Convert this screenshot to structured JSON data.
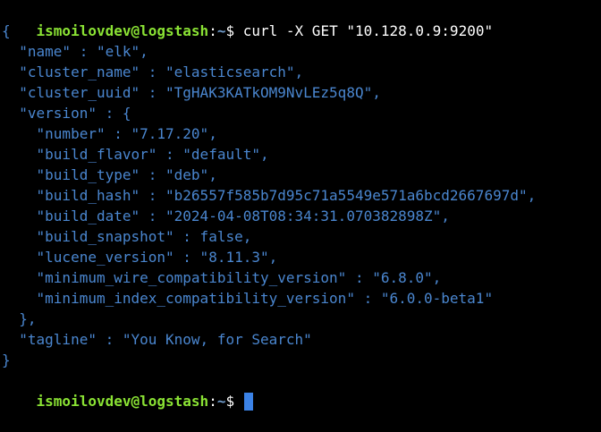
{
  "prompt": {
    "user_host": "ismoilovdev@logstash",
    "separator": ":",
    "path": "~",
    "symbol": "$"
  },
  "command": " curl -X GET \"10.128.0.9:9200\"",
  "output": [
    "{",
    "  \"name\" : \"elk\",",
    "  \"cluster_name\" : \"elasticsearch\",",
    "  \"cluster_uuid\" : \"TgHAK3KATkOM9NvLEz5q8Q\",",
    "  \"version\" : {",
    "    \"number\" : \"7.17.20\",",
    "    \"build_flavor\" : \"default\",",
    "    \"build_type\" : \"deb\",",
    "    \"build_hash\" : \"b26557f585b7d95c71a5549e571a6bcd2667697d\",",
    "    \"build_date\" : \"2024-04-08T08:34:31.070382898Z\",",
    "    \"build_snapshot\" : false,",
    "    \"lucene_version\" : \"8.11.3\",",
    "    \"minimum_wire_compatibility_version\" : \"6.8.0\",",
    "    \"minimum_index_compatibility_version\" : \"6.0.0-beta1\"",
    "  },",
    "  \"tagline\" : \"You Know, for Search\"",
    "}"
  ],
  "colors": {
    "background": "#000000",
    "prompt_user": "#8ae234",
    "prompt_path": "#729fcf",
    "json_text": "#4a86cf",
    "cursor": "#3b82e6"
  }
}
